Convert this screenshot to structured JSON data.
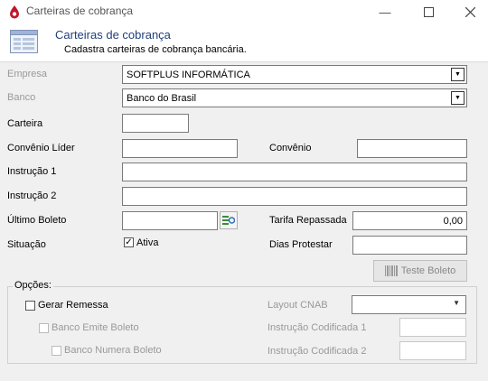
{
  "window": {
    "title": "Carteiras de cobrança"
  },
  "header": {
    "title": "Carteiras de cobrança",
    "subtitle": "Cadastra carteiras de cobrança bancária."
  },
  "form": {
    "empresa_label": "Empresa",
    "empresa_value": "SOFTPLUS INFORMÁTICA",
    "banco_label": "Banco",
    "banco_value": "Banco do Brasil",
    "carteira_label": "Carteira",
    "carteira_value": "",
    "convenio_lider_label": "Convênio Líder",
    "convenio_lider_value": "",
    "convenio_label": "Convênio",
    "convenio_value": "",
    "instrucao1_label": "Instrução 1",
    "instrucao1_value": "",
    "instrucao2_label": "Instrução 2",
    "instrucao2_value": "",
    "ultimo_boleto_label": "Último Boleto",
    "ultimo_boleto_value": "",
    "tarifa_label": "Tarifa Repassada",
    "tarifa_value": "0,00",
    "situacao_label": "Situação",
    "ativa_label": "Ativa",
    "ativa_checked": true,
    "dias_protestar_label": "Dias Protestar",
    "dias_protestar_value": ""
  },
  "teste_boleto_label": "Teste Boleto",
  "opcoes": {
    "legend": "Opções:",
    "gerar_remessa_label": "Gerar Remessa",
    "banco_emite_label": "Banco Emite Boleto",
    "banco_numera_label": "Banco Numera Boleto",
    "layout_cnab_label": "Layout CNAB",
    "layout_cnab_value": "",
    "instr_cod1_label": "Instrução Codificada 1",
    "instr_cod2_label": "Instrução Codificada 2"
  }
}
